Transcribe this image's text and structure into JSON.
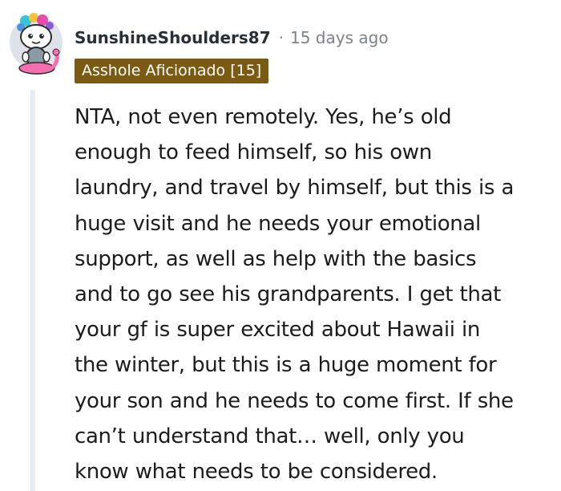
{
  "comment": {
    "author": "SunshineShoulders87",
    "separator": "·",
    "timestamp": "15 days ago",
    "flair": "Asshole Aficionado [15]",
    "avatar_icon": "snoo-avatar-icon",
    "body_lines": [
      "NTA, not even remotely. Yes, he’s old",
      "enough to feed himself, so his own",
      "laundry, and travel by himself, but this is a",
      "huge visit and he needs your emotional",
      "support, as well as help with the basics",
      "and to go see his grandparents. I get that",
      "your gf is super excited about Hawaii in",
      "the winter, but this is a huge moment for",
      "your son and he needs to come first. If she",
      "can’t understand that… well, only you",
      "know what needs to be considered."
    ]
  },
  "colors": {
    "flair_background": "#7b5a12",
    "thread_line": "#eaedef",
    "username": "#2a2f33",
    "timestamp": "#7c8287"
  }
}
